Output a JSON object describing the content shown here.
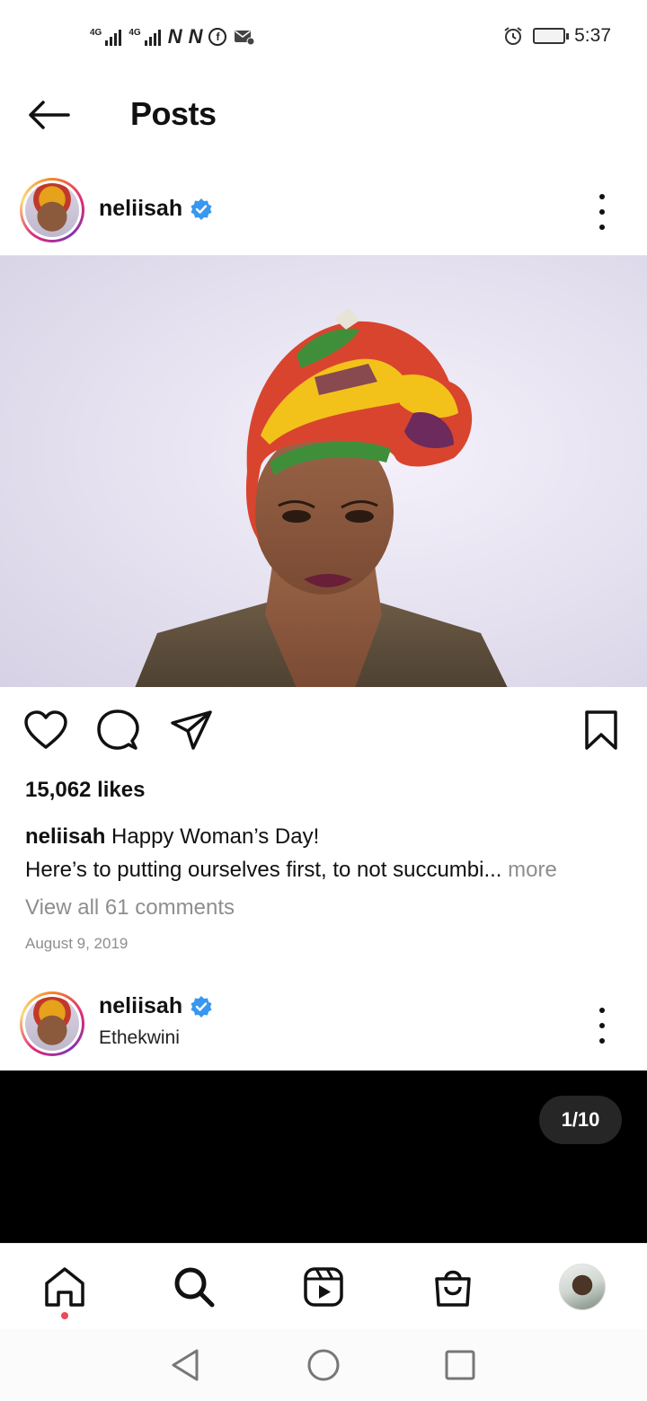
{
  "status_bar": {
    "network_1": "4G",
    "network_2": "4G",
    "notif_1": "N",
    "notif_2": "N",
    "facebook": "f",
    "time": "5:37"
  },
  "header": {
    "title": "Posts"
  },
  "post1": {
    "username": "neliisah",
    "likes": "15,062 likes",
    "caption_user": "neliisah",
    "caption_line1": "Happy Woman’s Day!",
    "caption_line2": "Here’s to putting ourselves first, to not succumbi...",
    "caption_more": " more",
    "view_comments": "View all 61 comments",
    "date": "August 9, 2019"
  },
  "post2": {
    "username": "neliisah",
    "location": "Ethekwini",
    "page_indicator": "1/10"
  },
  "colors": {
    "verified": "#3897f0",
    "secondary_text": "#8e8e8e",
    "notification_dot": "#ed4956"
  }
}
